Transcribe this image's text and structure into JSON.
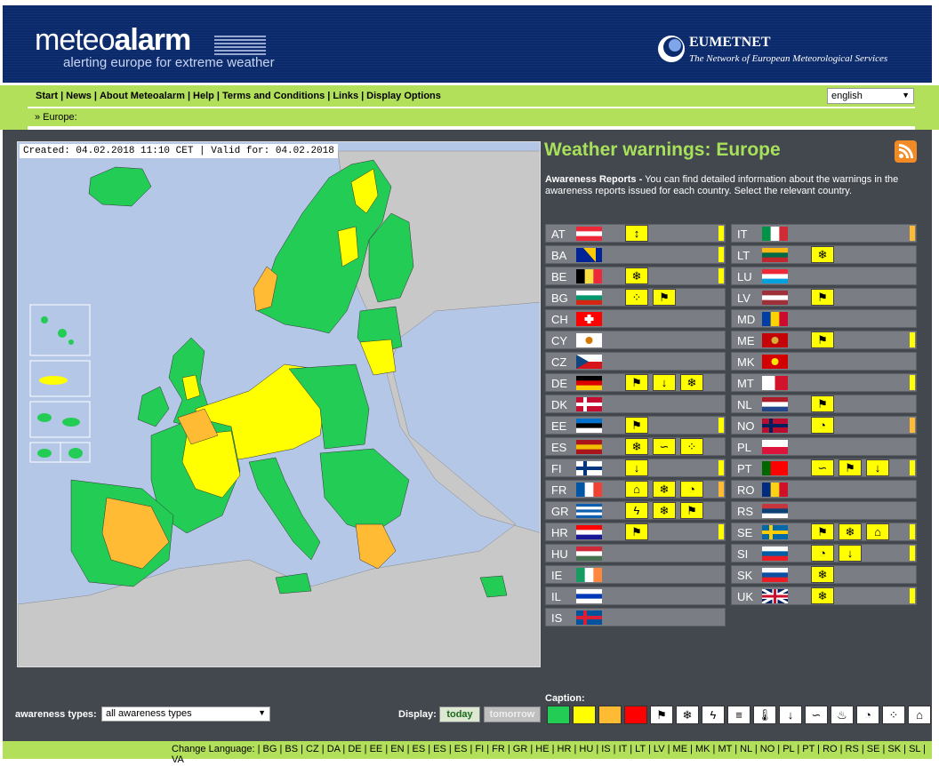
{
  "header": {
    "logo_light": "meteo",
    "logo_bold": "alarm",
    "logo_sub": "alerting europe for extreme weather",
    "eum_name": "EUMETNET",
    "eum_sub": "The Network of European Meteorological Services"
  },
  "nav": {
    "items": [
      "Start",
      "News",
      "About Meteoalarm",
      "Help",
      "Terms and Conditions",
      "Links",
      "Display Options"
    ],
    "language_selected": "english"
  },
  "breadcrumb": "» Europe:",
  "map": {
    "created_label": "Created: 04.02.2018 11:10 CET | Valid for: 04.02.2018"
  },
  "panel": {
    "title": "Weather warnings: Europe",
    "intro_bold": "Awareness Reports -",
    "intro_text": " You can find detailed information about the warnings in the awareness reports issued for each country. Select the relevant country."
  },
  "colors": {
    "green": "#22cc55",
    "yellow": "#ffff00",
    "orange": "#ffbb33",
    "red": "#ff0000",
    "accent_green": "#b3e05a",
    "banner_blue": "#0b2a6b",
    "panel_bg": "#43484f"
  },
  "countries_left": [
    {
      "code": "AT",
      "flag": "at",
      "level": "yellow",
      "icons": [
        "extreme-temp-icon"
      ]
    },
    {
      "code": "BA",
      "flag": "ba",
      "level": "yellow",
      "icons": []
    },
    {
      "code": "BE",
      "flag": "be",
      "level": "yellow",
      "icons": [
        "snow-ice-icon"
      ]
    },
    {
      "code": "BG",
      "flag": "bg",
      "level": "none",
      "icons": [
        "rain-icon",
        "wind-icon"
      ]
    },
    {
      "code": "CH",
      "flag": "ch",
      "level": "none",
      "icons": []
    },
    {
      "code": "CY",
      "flag": "cy",
      "level": "none",
      "icons": []
    },
    {
      "code": "CZ",
      "flag": "cz",
      "level": "none",
      "icons": []
    },
    {
      "code": "DE",
      "flag": "de",
      "level": "none",
      "icons": [
        "wind-icon",
        "low-temp-icon",
        "snow-ice-icon"
      ]
    },
    {
      "code": "DK",
      "flag": "dk",
      "level": "none",
      "icons": []
    },
    {
      "code": "EE",
      "flag": "ee",
      "level": "yellow",
      "icons": [
        "wind-icon"
      ]
    },
    {
      "code": "ES",
      "flag": "es",
      "level": "none",
      "icons": [
        "snow-ice-icon",
        "coastal-event-icon",
        "rain-icon"
      ]
    },
    {
      "code": "FI",
      "flag": "fi",
      "level": "yellow",
      "icons": [
        "low-temp-icon"
      ]
    },
    {
      "code": "FR",
      "flag": "fr",
      "level": "orange",
      "icons": [
        "flooding-icon",
        "snow-ice-icon",
        "avalanche-icon"
      ]
    },
    {
      "code": "GR",
      "flag": "gr",
      "level": "none",
      "icons": [
        "thunderstorm-icon",
        "snow-ice-icon",
        "wind-icon"
      ]
    },
    {
      "code": "HR",
      "flag": "hr",
      "level": "yellow",
      "icons": [
        "wind-icon"
      ]
    },
    {
      "code": "HU",
      "flag": "hu",
      "level": "none",
      "icons": []
    },
    {
      "code": "IE",
      "flag": "ie",
      "level": "none",
      "icons": []
    },
    {
      "code": "IL",
      "flag": "il",
      "level": "none",
      "icons": []
    },
    {
      "code": "IS",
      "flag": "is",
      "level": "none",
      "icons": []
    }
  ],
  "countries_right": [
    {
      "code": "IT",
      "flag": "it",
      "level": "orange",
      "icons": []
    },
    {
      "code": "LT",
      "flag": "lt",
      "level": "none",
      "icons": [
        "snow-ice-icon"
      ]
    },
    {
      "code": "LU",
      "flag": "lu",
      "level": "none",
      "icons": []
    },
    {
      "code": "LV",
      "flag": "lv",
      "level": "none",
      "icons": [
        "wind-icon"
      ]
    },
    {
      "code": "MD",
      "flag": "md",
      "level": "none",
      "icons": []
    },
    {
      "code": "ME",
      "flag": "me",
      "level": "yellow",
      "icons": [
        "wind-icon"
      ]
    },
    {
      "code": "MK",
      "flag": "mk",
      "level": "none",
      "icons": []
    },
    {
      "code": "MT",
      "flag": "mt",
      "level": "yellow",
      "icons": []
    },
    {
      "code": "NL",
      "flag": "nl",
      "level": "none",
      "icons": [
        "wind-icon"
      ]
    },
    {
      "code": "NO",
      "flag": "no",
      "level": "orange",
      "icons": [
        "avalanche-icon"
      ]
    },
    {
      "code": "PL",
      "flag": "pl",
      "level": "none",
      "icons": []
    },
    {
      "code": "PT",
      "flag": "pt",
      "level": "yellow",
      "icons": [
        "coastal-event-icon",
        "wind-icon",
        "low-temp-icon"
      ]
    },
    {
      "code": "RO",
      "flag": "ro",
      "level": "none",
      "icons": []
    },
    {
      "code": "RS",
      "flag": "rs",
      "level": "none",
      "icons": []
    },
    {
      "code": "SE",
      "flag": "se",
      "level": "yellow",
      "icons": [
        "wind-icon",
        "snow-ice-icon",
        "flooding-icon"
      ]
    },
    {
      "code": "SI",
      "flag": "si",
      "level": "yellow",
      "icons": [
        "avalanche-icon",
        "low-temp-icon"
      ]
    },
    {
      "code": "SK",
      "flag": "sk",
      "level": "none",
      "icons": [
        "snow-ice-icon"
      ]
    },
    {
      "code": "UK",
      "flag": "gb",
      "level": "yellow",
      "icons": [
        "snow-ice-icon"
      ]
    }
  ],
  "bottom": {
    "awareness_label": "awareness types:",
    "awareness_selected": "all awareness types",
    "display_label": "Display:",
    "today": "today",
    "tomorrow": "tomorrow",
    "caption_label": "Caption:",
    "caption_levels": [
      "green",
      "yellow",
      "orange",
      "red"
    ],
    "caption_icons": [
      "wind-icon",
      "snow-ice-icon",
      "thunderstorm-icon",
      "fog-icon",
      "high-temp-icon",
      "low-temp-icon",
      "coastal-event-icon",
      "forest-fire-icon",
      "avalanche-icon",
      "rain-icon",
      "flooding-icon"
    ]
  },
  "language_bar": "Change Language:  | BG | BS | CZ | DA | DE | EE | EN | ES | ES | ES | FI | FR | GR | HE | HR | HU | IS | IT | LT | LV | ME | MK | MT | NL | NO | PL | PT | RO | RS | SE | SK | SL | VA"
}
